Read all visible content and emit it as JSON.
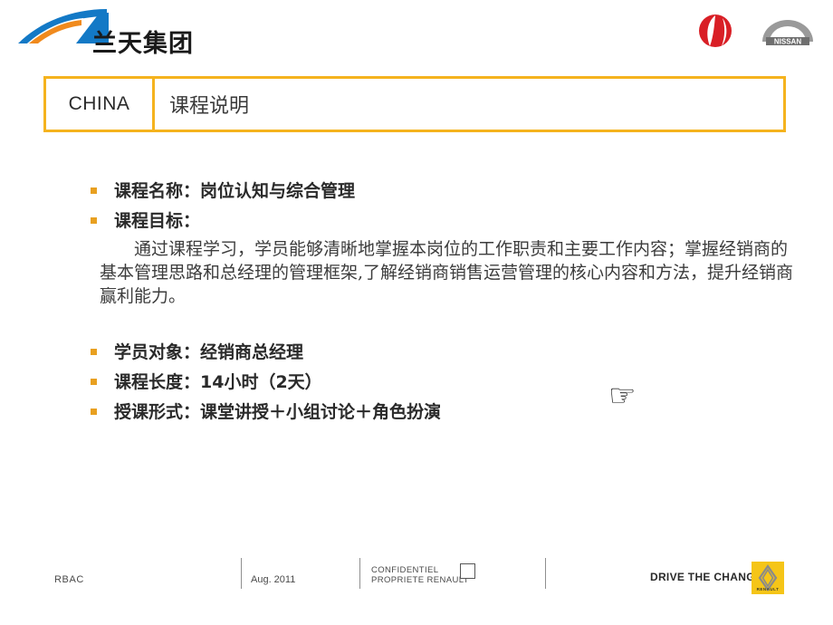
{
  "header": {
    "brand_logo_name": "lantian-group-logo",
    "brand_wordmark": "兰天集团",
    "partner_logos": [
      {
        "name": "dongfeng-logo",
        "label": "DONGFENG"
      },
      {
        "name": "nissan-logo",
        "label": "NISSAN"
      }
    ]
  },
  "title_bar": {
    "region_label": "CHINA",
    "title": "课程说明",
    "border_color": "#F5B31E"
  },
  "content": {
    "bullets_upper": [
      {
        "text": "课程名称：岗位认知与综合管理"
      },
      {
        "text": "课程目标："
      }
    ],
    "objective_paragraph": "通过课程学习，学员能够清晰地掌握本岗位的工作职责和主要工作内容；掌握经销商的基本管理思路和总经理的管理框架,了解经销商销售运营管理的核心内容和方法，提升经销商赢利能力。",
    "bullets_lower": [
      {
        "text": "学员对象：经销商总经理"
      },
      {
        "text": "课程长度：14小时（2天）"
      },
      {
        "text": "授课形式：课堂讲授＋小组讨论＋角色扮演"
      }
    ],
    "pointing_hand_glyph": "☞",
    "bullet_color": "#E8A020"
  },
  "footer": {
    "code": "RBAC",
    "date": "Aug. 2011",
    "confidential_line1": "CONFIDENTIEL",
    "confidential_line2": "PROPRIETE RENAULT",
    "tagline": "DRIVE THE CHANGE",
    "renault_wordmark": "RENAULT",
    "renault_logo_color": "#F5C518"
  }
}
